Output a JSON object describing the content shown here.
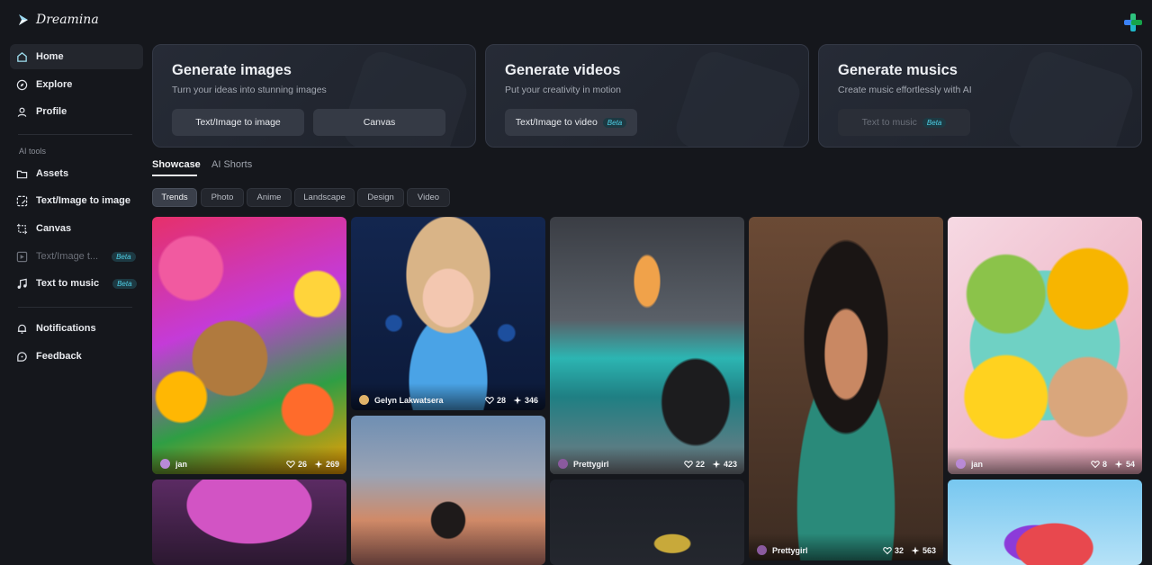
{
  "app": {
    "name": "Dreamina"
  },
  "sidebar": {
    "items": [
      {
        "label": "Home"
      },
      {
        "label": "Explore"
      },
      {
        "label": "Profile"
      }
    ],
    "tools_label": "AI tools",
    "tools": [
      {
        "label": "Assets"
      },
      {
        "label": "Text/Image to image"
      },
      {
        "label": "Canvas"
      },
      {
        "label": "Text/Image t...",
        "badge": "Beta"
      },
      {
        "label": "Text to music",
        "badge": "Beta"
      }
    ],
    "bottom": [
      {
        "label": "Notifications"
      },
      {
        "label": "Feedback"
      }
    ]
  },
  "cards": [
    {
      "title": "Generate images",
      "subtitle": "Turn your ideas into stunning images",
      "buttons": [
        {
          "label": "Text/Image to image"
        },
        {
          "label": "Canvas"
        }
      ]
    },
    {
      "title": "Generate videos",
      "subtitle": "Put your creativity in motion",
      "buttons": [
        {
          "label": "Text/Image to video",
          "badge": "Beta"
        }
      ]
    },
    {
      "title": "Generate musics",
      "subtitle": "Create music effortlessly with AI",
      "buttons": [
        {
          "label": "Text to music",
          "badge": "Beta"
        }
      ]
    }
  ],
  "tabs": [
    {
      "label": "Showcase"
    },
    {
      "label": "AI Shorts"
    }
  ],
  "filters": [
    "Trends",
    "Photo",
    "Anime",
    "Landscape",
    "Design",
    "Video"
  ],
  "gallery": [
    {
      "author": "jan",
      "likes": "26",
      "uses": "269"
    },
    {
      "author": "Gelyn Lakwatsera",
      "likes": "28",
      "uses": "346"
    },
    {
      "author": "Prettygirl",
      "likes": "22",
      "uses": "423"
    },
    {
      "author": "Prettygirl",
      "likes": "32",
      "uses": "563"
    },
    {
      "author": "jan",
      "likes": "8",
      "uses": "54"
    }
  ],
  "colors": {
    "background": "#15171c",
    "accent": "#4fd1e8",
    "card": "#262b36"
  }
}
